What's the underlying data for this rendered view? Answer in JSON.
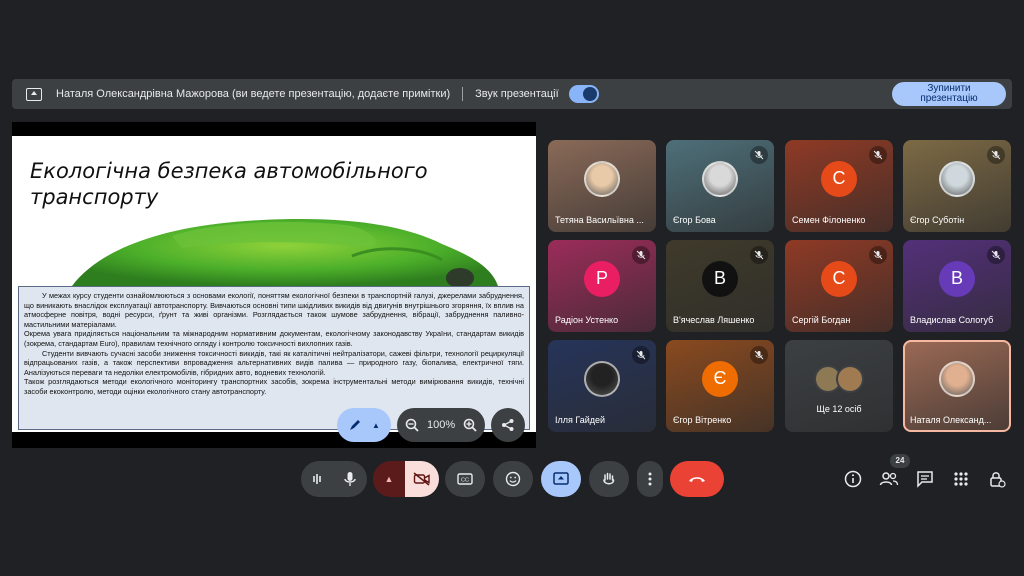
{
  "banner": {
    "presenter_text": "Наталя Олександрівна Мажорова (ви ведете презентацію, додаєте примітки)",
    "sound_label": "Звук презентації",
    "stop_button": "Зупинити презентацію"
  },
  "slide": {
    "title": "Екологічна безпека автомобільного транспорту",
    "paragraphs": [
      "У межах курсу студенти ознайомлюються з основами екології, поняттям екологічної безпеки в транспортній галузі, джерелами забруднення, що виникають внаслідок експлуатації автотранспорту. Вивчаються основні типи шкідливих викидів від двигунів внутрішнього згоряння, їх вплив на атмосферне повітря, водні ресурси, ґрунт та живі організми. Розглядається також шумове забруднення, вібрації, забруднення паливно-мастильними матеріалами.",
      "Окрема увага приділяється національним та міжнародним нормативним документам, екологічному законодавству України, стандартам викидів (зокрема, стандартам Euro), правилам технічного огляду і контролю токсичності вихлопних газів.",
      "Студенти вивчають сучасні засоби зниження токсичності викидів, такі як каталітичні нейтралізатори, сажеві фільтри, технології рециркуляції відпрацьованих газів, а також перспективи впровадження альтернативних видів палива — природного газу, біопалива, електричної тяги. Аналізуються переваги та недоліки електромобілів, гібридних авто, водневих технологій.",
      "Також розглядаються методи екологічного моніторингу транспортних засобів, зокрема інструментальні методи вимірювання викидів, технічні засоби екоконтролю, методи оцінки екологічного стану автотранспорту."
    ]
  },
  "slide_toolbar": {
    "zoom": "100%"
  },
  "participants": [
    {
      "name": "Тетяна Васильївна ...",
      "bg": "#8a6a58",
      "avatar_type": "photo",
      "avatar_color": "#e8c9a8",
      "muted": false
    },
    {
      "name": "Єгор Бова",
      "bg": "#4e6f79",
      "avatar_type": "photo",
      "avatar_color": "#d9d9d9",
      "muted": true
    },
    {
      "name": "Семен Філоненко",
      "bg": "#8f3a25",
      "avatar_type": "letter",
      "letter": "С",
      "avatar_color": "#e64a19",
      "muted": true
    },
    {
      "name": "Єгор Суботін",
      "bg": "#7d6a45",
      "avatar_type": "photo",
      "avatar_color": "#cfd8dc",
      "muted": true
    },
    {
      "name": "Радіон Устенко",
      "bg": "#9b2c5a",
      "avatar_type": "letter",
      "letter": "Р",
      "avatar_color": "#e91e63",
      "muted": true
    },
    {
      "name": "В'ячеслав Ляшенко",
      "bg": "#3f3a2a",
      "avatar_type": "letter",
      "letter": "В",
      "avatar_color": "#111111",
      "muted": true
    },
    {
      "name": "Сергій Богдан",
      "bg": "#8f3a25",
      "avatar_type": "letter",
      "letter": "С",
      "avatar_color": "#e64a19",
      "muted": true
    },
    {
      "name": "Владислав Сологуб",
      "bg": "#53307a",
      "avatar_type": "letter",
      "letter": "В",
      "avatar_color": "#673ab7",
      "muted": true
    },
    {
      "name": "Ілля Гайдей",
      "bg": "#26345a",
      "avatar_type": "photo",
      "avatar_color": "#222222",
      "muted": true
    },
    {
      "name": "Єгор Вітренко",
      "bg": "#8a4a1f",
      "avatar_type": "letter",
      "letter": "Є",
      "avatar_color": "#ef6c00",
      "muted": true
    },
    {
      "name": "Ще 12 осіб",
      "bg": "#3c4043",
      "avatar_type": "group",
      "avatar_color": "#8d7a55",
      "muted": false
    },
    {
      "name": "Наталя Олександ...",
      "bg": "#9c6a55",
      "avatar_type": "photo",
      "avatar_color": "#e0b090",
      "muted": false,
      "highlight": true
    }
  ],
  "controls": {
    "participants_count": "24"
  },
  "colors": {
    "accent": "#a8c7fa",
    "end_call": "#ea4335",
    "camera_off_bg": "#f9dedc"
  },
  "icons": [
    "presentation-icon",
    "sound-icon",
    "pen-icon",
    "zoom-out-icon",
    "zoom-in-icon",
    "share-icon",
    "audio-icon",
    "mic-icon",
    "camera-off-icon",
    "captions-icon",
    "emoji-icon",
    "present-icon",
    "hand-icon",
    "more-icon",
    "end-call-icon",
    "info-icon",
    "people-icon",
    "chat-icon",
    "activities-icon",
    "host-controls-icon"
  ]
}
